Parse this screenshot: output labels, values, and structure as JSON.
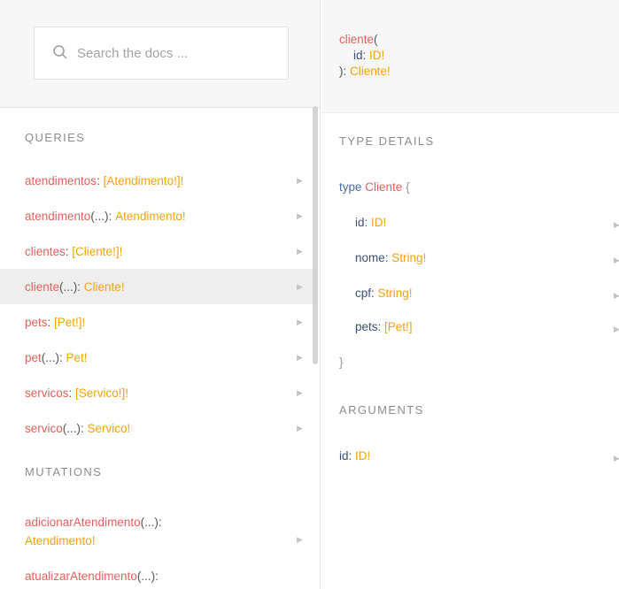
{
  "search": {
    "placeholder": "Search the docs ..."
  },
  "queries": {
    "title": "QUERIES",
    "items": [
      {
        "name": "atendimentos",
        "args": "",
        "type": "[Atendimento!]!"
      },
      {
        "name": "atendimento",
        "args": "(...)",
        "type": "Atendimento!"
      },
      {
        "name": "clientes",
        "args": "",
        "type": "[Cliente!]!"
      },
      {
        "name": "cliente",
        "args": "(...)",
        "type": "Cliente!"
      },
      {
        "name": "pets",
        "args": "",
        "type": "[Pet!]!"
      },
      {
        "name": "pet",
        "args": "(...)",
        "type": "Pet!"
      },
      {
        "name": "servicos",
        "args": "",
        "type": "[Servico!]!"
      },
      {
        "name": "servico",
        "args": "(...)",
        "type": "Servico!"
      }
    ]
  },
  "mutations": {
    "title": "MUTATIONS",
    "items": [
      {
        "name": "adicionarAtendimento",
        "args": "(...)",
        "type": "Atendimento!"
      },
      {
        "name": "atualizarAtendimento",
        "args": "(...):",
        "type": ""
      }
    ]
  },
  "doc": {
    "header": {
      "name": "cliente",
      "open": "(",
      "arg_name": "id",
      "arg_type": "ID!",
      "close": "): ",
      "return_type": "Cliente!"
    },
    "type_details_title": "TYPE DETAILS",
    "type_keyword": "type",
    "type_name": "Cliente",
    "open_brace": "{",
    "close_brace": "}",
    "fields": [
      {
        "name": "id",
        "type": "ID!"
      },
      {
        "name": "nome",
        "type": "String!"
      },
      {
        "name": "cpf",
        "type": "String!"
      },
      {
        "name": "pets",
        "type": "[Pet!]"
      }
    ],
    "arguments_title": "ARGUMENTS",
    "arguments": [
      {
        "name": "id",
        "type": "ID!"
      }
    ]
  },
  "icons": {
    "search": "search-icon",
    "arrow": "chevron-right-icon"
  }
}
